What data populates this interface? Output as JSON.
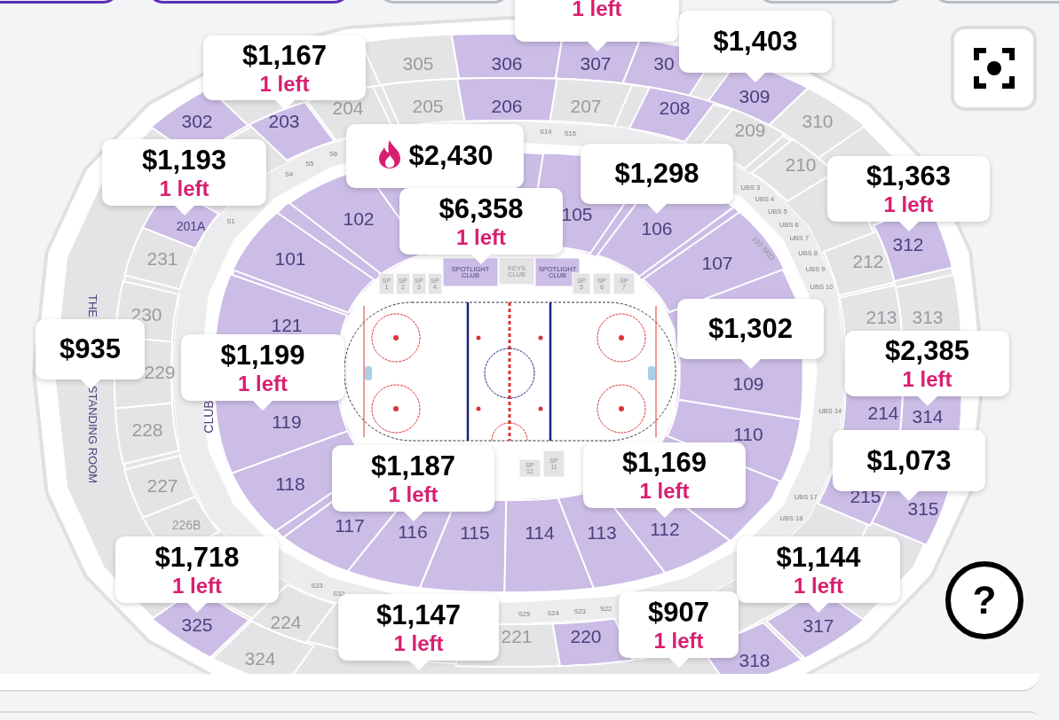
{
  "top_chips": [
    {
      "selected": true
    },
    {
      "selected": true
    },
    {
      "selected": false
    },
    {
      "selected": false
    },
    {
      "selected": false
    }
  ],
  "sections": [
    {
      "label": "302",
      "available": true
    },
    {
      "label": "305",
      "available": false
    },
    {
      "label": "306",
      "available": true
    },
    {
      "label": "307",
      "available": true
    },
    {
      "label": "30",
      "available": true
    },
    {
      "label": "309",
      "available": true
    },
    {
      "label": "310",
      "available": false
    },
    {
      "label": "312",
      "available": true
    },
    {
      "label": "313",
      "available": false
    },
    {
      "label": "314",
      "available": true
    },
    {
      "label": "315",
      "available": true
    },
    {
      "label": "317",
      "available": true
    },
    {
      "label": "318",
      "available": true
    },
    {
      "label": "324",
      "available": false
    },
    {
      "label": "325",
      "available": true
    },
    {
      "label": "203",
      "available": true
    },
    {
      "label": "204",
      "available": false
    },
    {
      "label": "205",
      "available": false
    },
    {
      "label": "206",
      "available": true
    },
    {
      "label": "207",
      "available": false
    },
    {
      "label": "208",
      "available": true
    },
    {
      "label": "209",
      "available": false
    },
    {
      "label": "210",
      "available": false
    },
    {
      "label": "212",
      "available": false
    },
    {
      "label": "213",
      "available": false
    },
    {
      "label": "214",
      "available": true
    },
    {
      "label": "215",
      "available": true
    },
    {
      "label": "220",
      "available": true
    },
    {
      "label": "221",
      "available": false
    },
    {
      "label": "224",
      "available": false
    },
    {
      "label": "226B",
      "available": false
    },
    {
      "label": "227",
      "available": false
    },
    {
      "label": "228",
      "available": false
    },
    {
      "label": "229",
      "available": false
    },
    {
      "label": "230",
      "available": false
    },
    {
      "label": "231",
      "available": false
    },
    {
      "label": "201A",
      "available": true
    },
    {
      "label": "102",
      "available": true
    },
    {
      "label": "105",
      "available": true
    },
    {
      "label": "106",
      "available": true
    },
    {
      "label": "101",
      "available": true
    },
    {
      "label": "107",
      "available": true
    },
    {
      "label": "121",
      "available": true
    },
    {
      "label": "109",
      "available": true
    },
    {
      "label": "119",
      "available": true
    },
    {
      "label": "110",
      "available": true
    },
    {
      "label": "118",
      "available": true
    },
    {
      "label": "117",
      "available": true
    },
    {
      "label": "116",
      "available": true
    },
    {
      "label": "115",
      "available": true
    },
    {
      "label": "114",
      "available": true
    },
    {
      "label": "113",
      "available": true
    },
    {
      "label": "112",
      "available": true
    }
  ],
  "area_labels": [
    "THE",
    "STANDING ROOM",
    "CLUB",
    "107 SRO"
  ],
  "suites": [
    "S1",
    "S4",
    "S5",
    "S6",
    "S14",
    "S15",
    "UBS 3",
    "UBS 4",
    "UBS 5",
    "UBS 6",
    "UBS 7",
    "UBS 8",
    "UBS 9",
    "UBS 10",
    "UBS 14",
    "UBS 17",
    "UBS 18",
    "S33",
    "S32",
    "S25",
    "S24",
    "S23",
    "S22"
  ],
  "rink_boxes": [
    {
      "label": "SP 1",
      "available": false
    },
    {
      "label": "SP 2",
      "available": false
    },
    {
      "label": "SP 3",
      "available": false
    },
    {
      "label": "SP 4",
      "available": false
    },
    {
      "label": "SPOTLIGHT CLUB",
      "available": true
    },
    {
      "label": "KEYS CLUB",
      "available": false
    },
    {
      "label": "SPOTLIGHT CLUB",
      "available": true
    },
    {
      "label": "SP 5",
      "available": false
    },
    {
      "label": "SP 6",
      "available": false
    },
    {
      "label": "SP 7",
      "available": false
    },
    {
      "label": "SP 12",
      "available": false
    },
    {
      "label": "SP 11",
      "available": false
    }
  ],
  "callouts": [
    {
      "price": "$1,167",
      "left": "1 left",
      "hot": false
    },
    {
      "left": "1 left",
      "hot": false
    },
    {
      "price": "$1,403",
      "hot": false
    },
    {
      "price": "$1,193",
      "left": "1 left",
      "hot": false
    },
    {
      "price": "$2,430",
      "hot": true
    },
    {
      "price": "$6,358",
      "left": "1 left",
      "hot": false
    },
    {
      "price": "$1,298",
      "hot": false
    },
    {
      "price": "$1,363",
      "left": "1 left",
      "hot": false
    },
    {
      "price": "$935",
      "hot": false
    },
    {
      "price": "$1,199",
      "left": "1 left",
      "hot": false
    },
    {
      "price": "$1,302",
      "hot": false
    },
    {
      "price": "$2,385",
      "left": "1 left",
      "hot": false
    },
    {
      "price": "$1,187",
      "left": "1 left",
      "hot": false
    },
    {
      "price": "$1,169",
      "left": "1 left",
      "hot": false
    },
    {
      "price": "$1,073",
      "hot": false
    },
    {
      "price": "$1,718",
      "left": "1 left",
      "hot": false
    },
    {
      "price": "$1,144",
      "left": "1 left",
      "hot": false
    },
    {
      "price": "$1,147",
      "left": "1 left",
      "hot": false
    },
    {
      "price": "$907",
      "left": "1 left",
      "hot": false
    }
  ],
  "help_button": {
    "label": "?"
  }
}
